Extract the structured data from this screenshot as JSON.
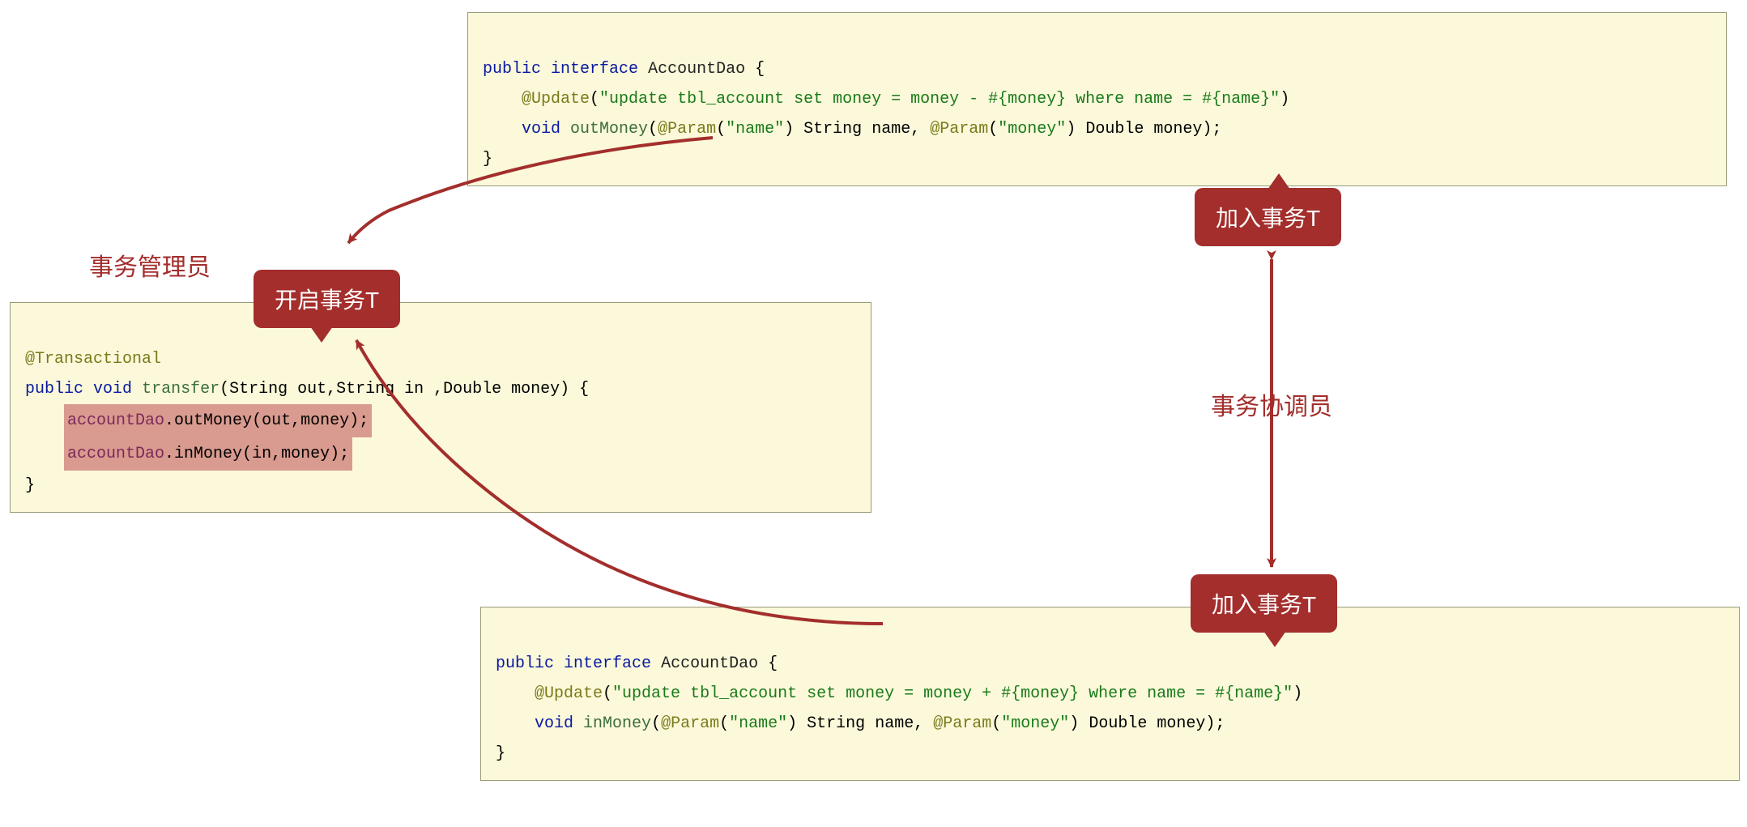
{
  "boxes": {
    "top": {
      "line1_public": "public",
      "line1_interface": "interface",
      "line1_class": "AccountDao",
      "line1_brace": "{",
      "line2_anno": "@Update",
      "line2_paren_open": "(",
      "line2_string": "\"update tbl_account set money = money - #{money} where name = #{name}\"",
      "line2_paren_close": ")",
      "line3_void": "void",
      "line3_method": "outMoney",
      "line3_paren_open": "(",
      "line3_param1_anno": "@Param",
      "line3_param1_po": "(",
      "line3_param1_str": "\"name\"",
      "line3_param1_pc": ")",
      "line3_param1_type": "String",
      "line3_param1_name": "name",
      "line3_comma": ",",
      "line3_param2_anno": "@Param",
      "line3_param2_po": "(",
      "line3_param2_str": "\"money\"",
      "line3_param2_pc": ")",
      "line3_param2_type": "Double",
      "line3_param2_name": "money",
      "line3_paren_close": ");",
      "line4_brace": "}"
    },
    "left": {
      "line1_anno": "@Transactional",
      "line2_public": "public",
      "line2_void": "void",
      "line2_method": "transfer",
      "line2_args": "(String out,String in ,Double money) {",
      "line3_member": "accountDao",
      "line3_call": ".outMoney(out,money);",
      "line4_member": "accountDao",
      "line4_call": ".inMoney(in,money);",
      "line5_brace": "}"
    },
    "bottom": {
      "line1_public": "public",
      "line1_interface": "interface",
      "line1_class": "AccountDao",
      "line1_brace": "{",
      "line2_anno": "@Update",
      "line2_paren_open": "(",
      "line2_string": "\"update tbl_account set money = money + #{money} where name = #{name}\"",
      "line2_paren_close": ")",
      "line3_void": "void",
      "line3_method": "inMoney",
      "line3_paren_open": "(",
      "line3_param1_anno": "@Param",
      "line3_param1_po": "(",
      "line3_param1_str": "\"name\"",
      "line3_param1_pc": ")",
      "line3_param1_type": "String",
      "line3_param1_name": "name",
      "line3_comma": ",",
      "line3_param2_anno": "@Param",
      "line3_param2_po": "(",
      "line3_param2_str": "\"money\"",
      "line3_param2_pc": ")",
      "line3_param2_type": "Double",
      "line3_param2_name": "money",
      "line3_paren_close": ");",
      "line4_brace": "}"
    }
  },
  "badges": {
    "open": "开启事务T",
    "join1": "加入事务T",
    "join2": "加入事务T"
  },
  "labels": {
    "manager": "事务管理员",
    "coordinator": "事务协调员"
  }
}
